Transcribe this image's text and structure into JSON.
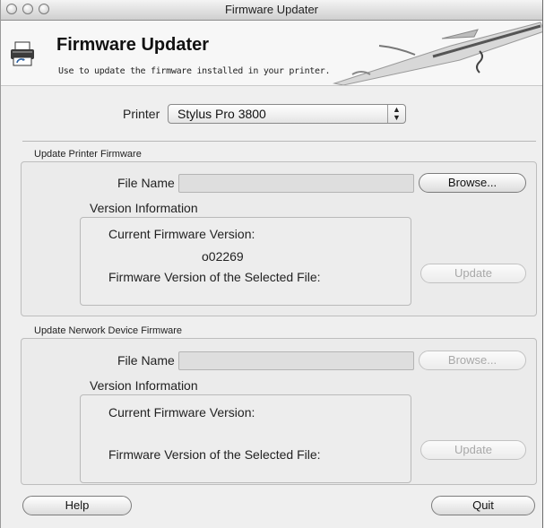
{
  "window": {
    "title": "Firmware Updater"
  },
  "header": {
    "title": "Firmware Updater",
    "subtitle": "Use to update the firmware installed in your printer."
  },
  "printer": {
    "label": "Printer",
    "selected": "Stylus Pro 3800"
  },
  "printer_section": {
    "group_label": "Update Printer Firmware",
    "file_name_label": "File Name",
    "file_name_value": "",
    "browse_label": "Browse...",
    "version_info_label": "Version Information",
    "current_version_label": "Current Firmware Version:",
    "current_version_value": "o02269",
    "selected_version_label": "Firmware Version of the Selected File:",
    "update_label": "Update"
  },
  "network_section": {
    "group_label": "Update Nerwork Device Firmware",
    "file_name_label": "File Name",
    "file_name_value": "",
    "browse_label": "Browse...",
    "version_info_label": "Version Information",
    "current_version_label": "Current Firmware Version:",
    "current_version_value": "",
    "selected_version_label": "Firmware Version of the Selected File:",
    "update_label": "Update"
  },
  "footer": {
    "help_label": "Help",
    "quit_label": "Quit"
  }
}
